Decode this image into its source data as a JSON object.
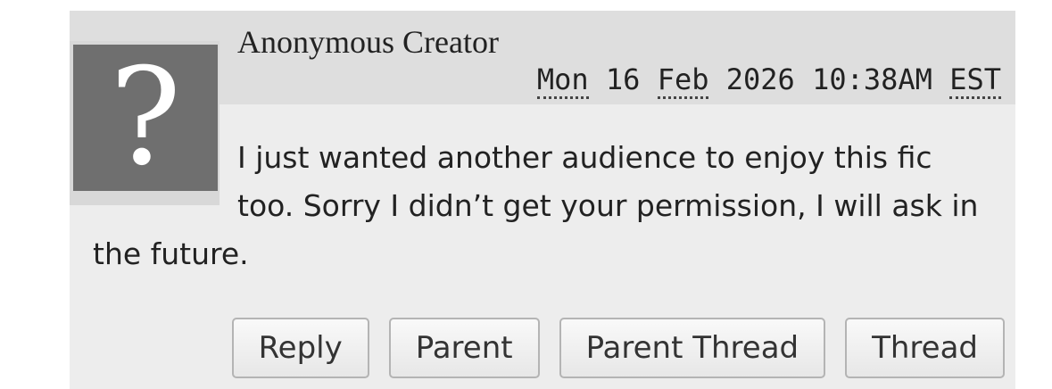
{
  "comment": {
    "author": "Anonymous Creator",
    "avatar_icon": "question-mark-icon",
    "avatar_glyph": "?",
    "datetime": {
      "weekday": "Mon",
      "day": "16",
      "month": "Feb",
      "year": "2026",
      "time": "10:38AM",
      "timezone": "EST"
    },
    "text": "I just wanted another audience to enjoy this fic too. Sorry I didn’t get your permission, I will ask in the future."
  },
  "actions": {
    "reply": "Reply",
    "parent": "Parent",
    "parent_thread": "Parent Thread",
    "thread": "Thread"
  }
}
